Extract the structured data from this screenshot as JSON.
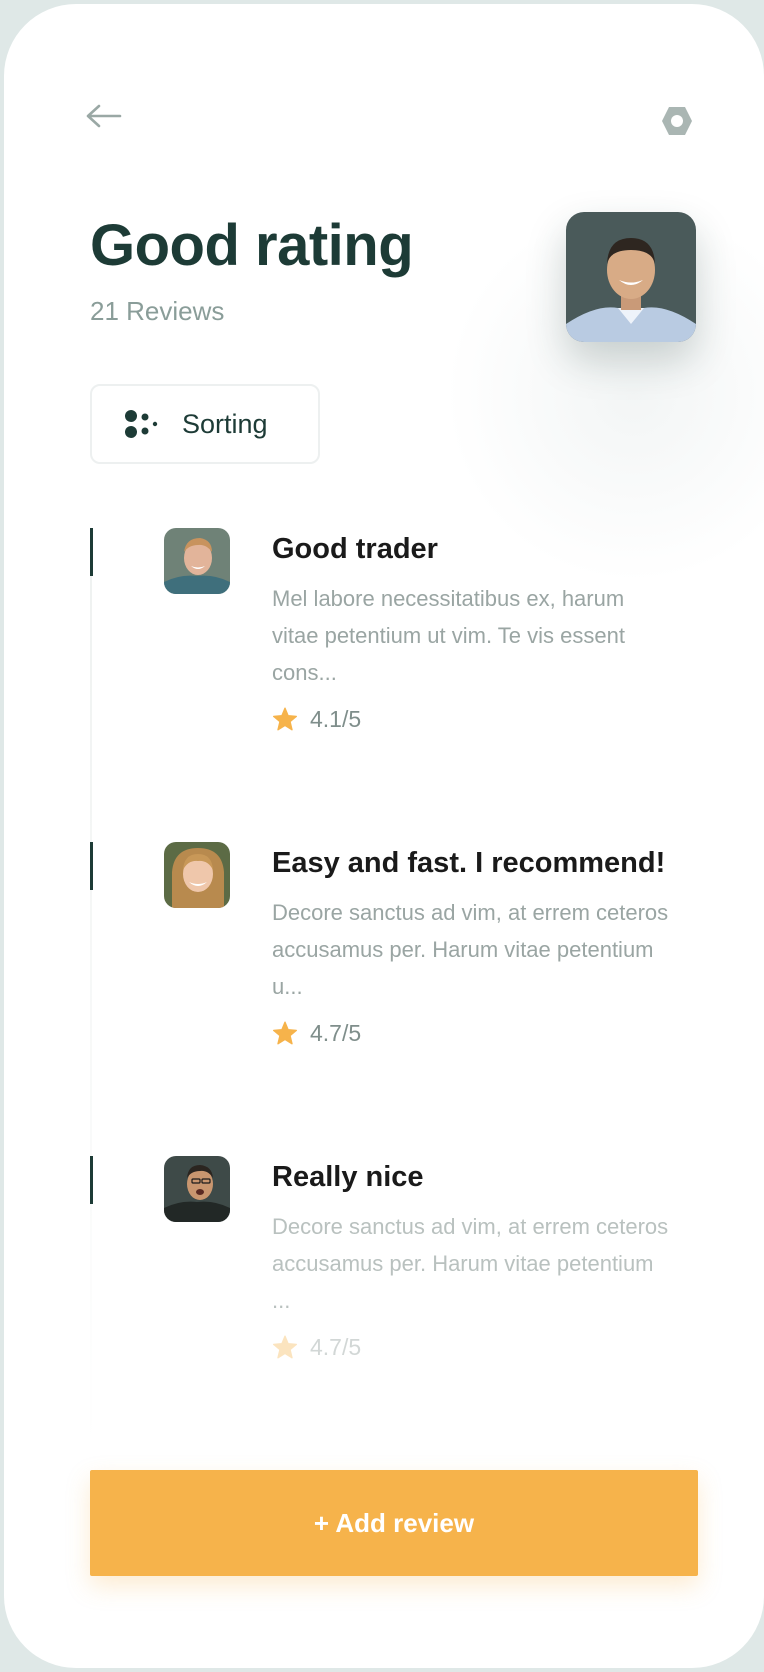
{
  "header": {
    "back_icon": "arrow-left-icon",
    "settings_icon": "hexagon-nut-icon",
    "title": "Good rating",
    "reviews_count": "21 Reviews",
    "profile_avatar": "profile-photo"
  },
  "sorting": {
    "icon": "dots-grid-icon",
    "label": "Sorting"
  },
  "reviews": [
    {
      "title": "Good trader",
      "body": "Mel labore necessitatibus ex, harum vitae petentium ut vim. Te vis essent cons...",
      "rating": "4.1/5"
    },
    {
      "title": "Easy and fast. I recommend!",
      "body": "Decore sanctus ad vim, at errem ceteros accusamus per. Harum vitae petentium u...",
      "rating": "4.7/5"
    },
    {
      "title": "Really nice",
      "body": "Decore sanctus ad vim, at errem ceteros accusamus per. Harum vitae petentium ...",
      "rating": "4.7/5"
    }
  ],
  "actions": {
    "add_review": "+ Add review"
  },
  "colors": {
    "primary_dark": "#1d3b36",
    "accent": "#f6b34b",
    "muted_text": "#9aa5a3",
    "star": "#f6b34b"
  }
}
